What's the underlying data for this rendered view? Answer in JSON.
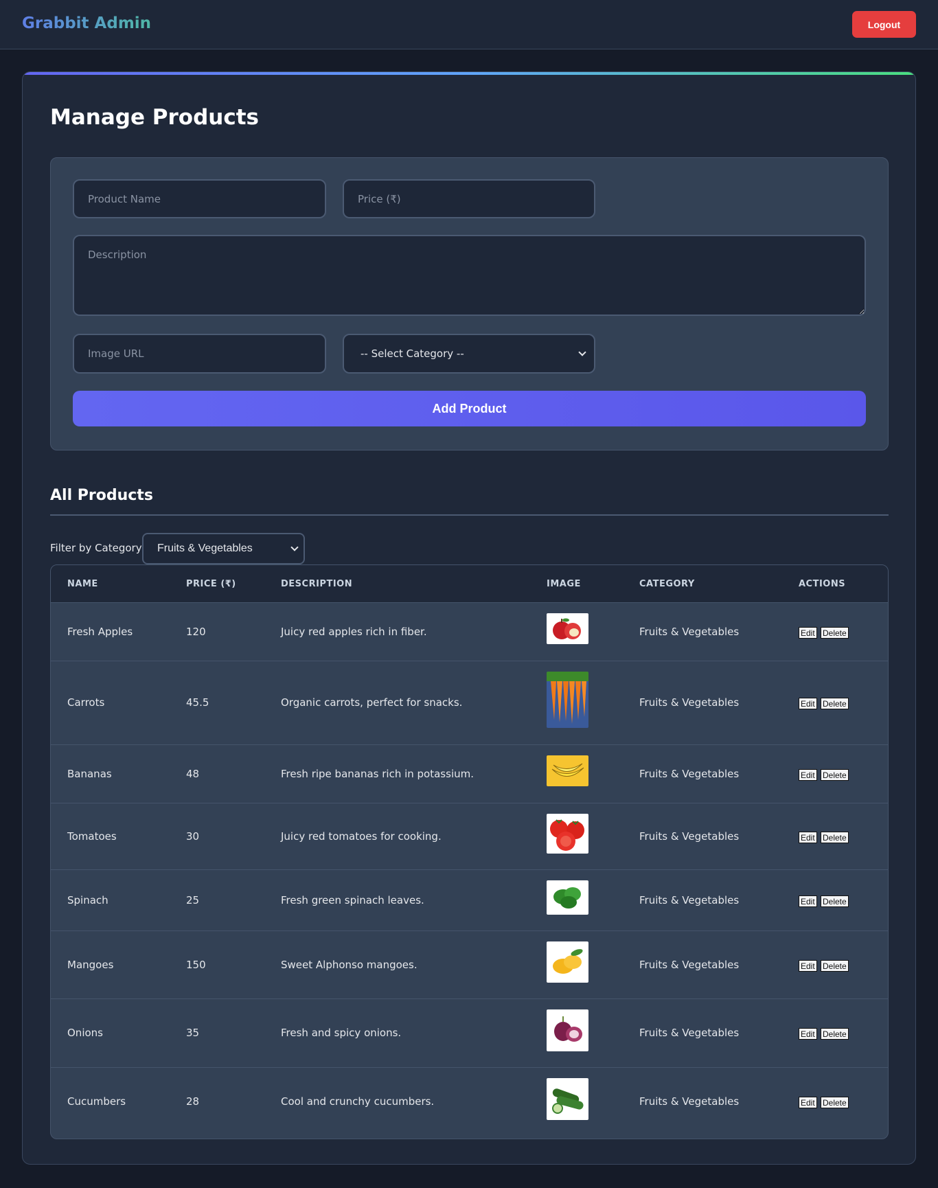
{
  "header": {
    "brand": "Grabbit Admin",
    "logout_label": "Logout"
  },
  "page": {
    "title": "Manage Products"
  },
  "form": {
    "name_placeholder": "Product Name",
    "price_placeholder": "Price (₹)",
    "description_placeholder": "Description",
    "image_placeholder": "Image URL",
    "category_selected": "-- Select Category --",
    "add_label": "Add Product"
  },
  "list": {
    "title": "All Products",
    "filter_label": "Filter by Category:",
    "filter_selected": "Fruits & Vegetables"
  },
  "table": {
    "headers": [
      "NAME",
      "PRICE (₹)",
      "DESCRIPTION",
      "IMAGE",
      "CATEGORY",
      "ACTIONS"
    ],
    "edit_label": "Edit",
    "delete_label": "Delete",
    "rows": [
      {
        "name": "Fresh Apples",
        "price": "120",
        "description": "Juicy red apples rich in fiber.",
        "image": "apples",
        "category": "Fruits & Vegetables"
      },
      {
        "name": "Carrots",
        "price": "45.5",
        "description": "Organic carrots, perfect for snacks.",
        "image": "carrots",
        "category": "Fruits & Vegetables"
      },
      {
        "name": "Bananas",
        "price": "48",
        "description": "Fresh ripe bananas rich in potassium.",
        "image": "bananas",
        "category": "Fruits & Vegetables"
      },
      {
        "name": "Tomatoes",
        "price": "30",
        "description": "Juicy red tomatoes for cooking.",
        "image": "tomatoes",
        "category": "Fruits & Vegetables"
      },
      {
        "name": "Spinach",
        "price": "25",
        "description": "Fresh green spinach leaves.",
        "image": "spinach",
        "category": "Fruits & Vegetables"
      },
      {
        "name": "Mangoes",
        "price": "150",
        "description": "Sweet Alphonso mangoes.",
        "image": "mangoes",
        "category": "Fruits & Vegetables"
      },
      {
        "name": "Onions",
        "price": "35",
        "description": "Fresh and spicy onions.",
        "image": "onions",
        "category": "Fruits & Vegetables"
      },
      {
        "name": "Cucumbers",
        "price": "28",
        "description": "Cool and crunchy cucumbers.",
        "image": "cucumbers",
        "category": "Fruits & Vegetables"
      }
    ]
  },
  "colors": {
    "page_bg": "#151b28",
    "panel_bg": "#334155",
    "accent": "#6366f1",
    "danger": "#e53e3e"
  }
}
